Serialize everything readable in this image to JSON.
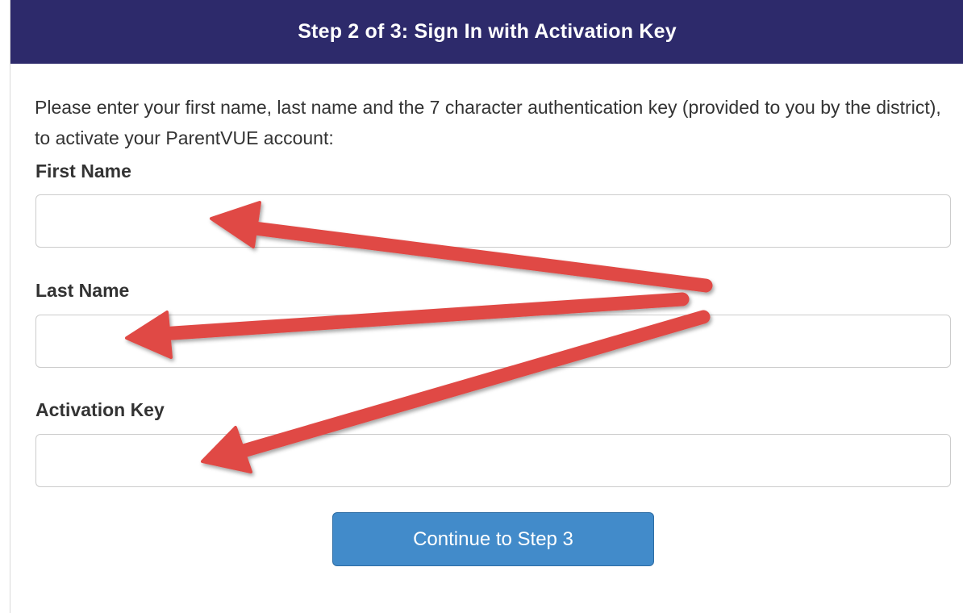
{
  "header": {
    "title": "Step 2 of 3: Sign In with Activation Key"
  },
  "intro": {
    "text": "Please enter your first name, last name and the 7 character authentication key (provided to you by the district), to activate your ParentVUE account:"
  },
  "form": {
    "first_name_label": "First Name",
    "first_name_value": "",
    "last_name_label": "Last Name",
    "last_name_value": "",
    "activation_key_label": "Activation Key",
    "activation_key_value": "",
    "continue_label": "Continue to Step 3"
  },
  "colors": {
    "header_bg": "#2d2a6b",
    "button_bg": "#428bca",
    "annotation_arrow": "#e04a45"
  }
}
